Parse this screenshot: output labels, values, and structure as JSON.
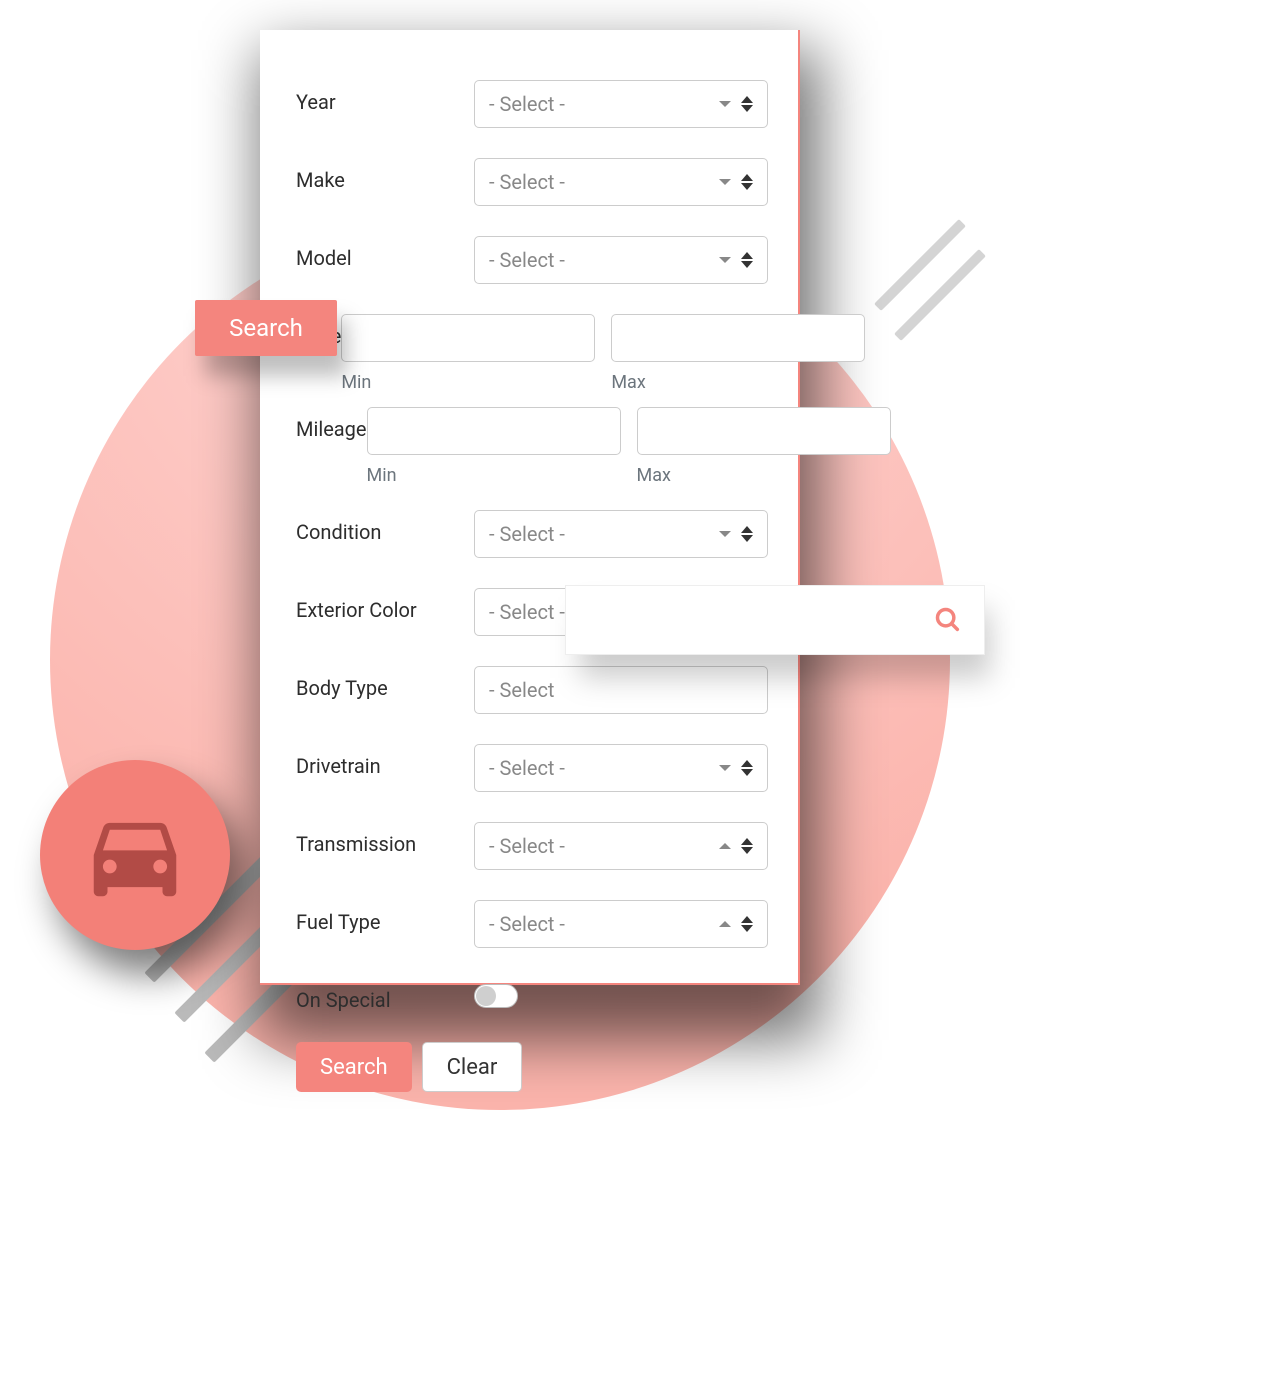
{
  "colors": {
    "accent": "#f4857e",
    "text": "#2d2d2d",
    "muted": "#888888"
  },
  "decor": {
    "car_icon": "car-icon",
    "search_pill_label": "Search",
    "search_bar_icon": "search-icon"
  },
  "form": {
    "fields": {
      "year": {
        "label": "Year",
        "placeholder": "- Select -",
        "arrow": "down"
      },
      "make": {
        "label": "Make",
        "placeholder": "- Select -",
        "arrow": "down"
      },
      "model": {
        "label": "Model",
        "placeholder": "- Select -",
        "arrow": "down"
      },
      "price": {
        "label": "Price",
        "min_label": "Min",
        "max_label": "Max",
        "min_value": "",
        "max_value": ""
      },
      "mileage": {
        "label": "Mileage",
        "min_label": "Min",
        "max_label": "Max",
        "min_value": "",
        "max_value": ""
      },
      "condition": {
        "label": "Condition",
        "placeholder": "- Select -",
        "arrow": "down"
      },
      "exterior_color": {
        "label": "Exterior Color",
        "placeholder": "- Select -",
        "arrow": "down"
      },
      "body_type": {
        "label": "Body Type",
        "placeholder": "- Select"
      },
      "drivetrain": {
        "label": "Drivetrain",
        "placeholder": "- Select -",
        "arrow": "down"
      },
      "transmission": {
        "label": "Transmission",
        "placeholder": "- Select -",
        "arrow": "up"
      },
      "fuel_type": {
        "label": "Fuel Type",
        "placeholder": "- Select -",
        "arrow": "up"
      },
      "on_special": {
        "label": "On Special",
        "value": false
      }
    },
    "buttons": {
      "search": "Search",
      "clear": "Clear"
    }
  }
}
